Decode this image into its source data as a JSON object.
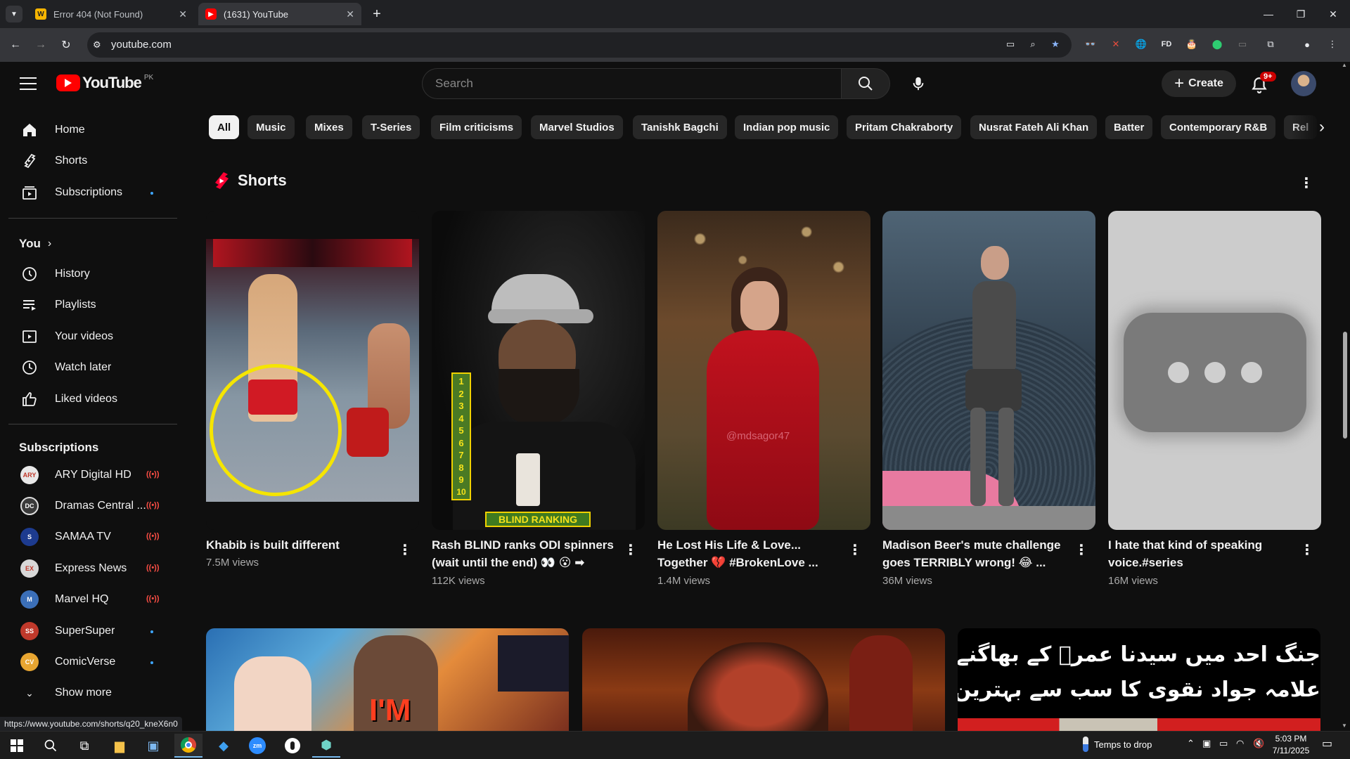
{
  "browser": {
    "tabs": [
      {
        "title": "Error 404 (Not Found)",
        "favicon": "W"
      },
      {
        "title": "(1631) YouTube",
        "favicon": "yt"
      }
    ],
    "url": "youtube.com",
    "status_url": "https://www.youtube.com/shorts/q20_kneX6n0"
  },
  "youtube": {
    "logo_text": "YouTube",
    "region": "PK",
    "search_placeholder": "Search",
    "create_label": "Create",
    "notif_badge": "9+",
    "brand_red": "#ff0000"
  },
  "sidebar": {
    "main": [
      {
        "label": "Home",
        "icon": "home-icon"
      },
      {
        "label": "Shorts",
        "icon": "shorts-icon"
      },
      {
        "label": "Subscriptions",
        "icon": "subscriptions-icon"
      }
    ],
    "you_heading": "You",
    "you": [
      {
        "label": "History",
        "icon": "history-icon"
      },
      {
        "label": "Playlists",
        "icon": "playlists-icon"
      },
      {
        "label": "Your videos",
        "icon": "your-videos-icon"
      },
      {
        "label": "Watch later",
        "icon": "watch-later-icon"
      },
      {
        "label": "Liked videos",
        "icon": "liked-icon"
      }
    ],
    "subs_heading": "Subscriptions",
    "subscriptions": [
      {
        "label": "ARY Digital HD",
        "color": "#e8e8e8",
        "text": "ARY",
        "status": "live"
      },
      {
        "label": "Dramas Central ...",
        "color": "#3a3a3a",
        "text": "DC",
        "status": "live"
      },
      {
        "label": "SAMAA TV",
        "color": "#1d3b8f",
        "text": "S",
        "status": "live"
      },
      {
        "label": "Express News",
        "color": "#d8d8d8",
        "text": "EX",
        "status": "live"
      },
      {
        "label": "Marvel HQ",
        "color": "#3b6fb8",
        "text": "M",
        "status": "live"
      },
      {
        "label": "SuperSuper",
        "color": "#c0392b",
        "text": "SS",
        "status": "dot"
      },
      {
        "label": "ComicVerse",
        "color": "#e7a531",
        "text": "CV",
        "status": "dot"
      }
    ],
    "show_more": "Show more"
  },
  "chips": [
    "All",
    "Music",
    "Mixes",
    "T-Series",
    "Film criticisms",
    "Marvel Studios",
    "Tanishk Bagchi",
    "Indian pop music",
    "Pritam Chakraborty",
    "Nusrat Fateh Ali Khan",
    "Batter",
    "Contemporary R&B",
    "Rel"
  ],
  "shorts": {
    "heading": "Shorts",
    "items": [
      {
        "title": "Khabib is built different",
        "views": "7.5M views"
      },
      {
        "title": "Rash BLIND ranks ODI spinners (wait until the end) 👀 😮 ➡",
        "views": "112K views"
      },
      {
        "title": "He Lost His Life & Love... Together 💔 #BrokenLove ...",
        "views": "1.4M views"
      },
      {
        "title": "Madison Beer's mute challenge goes TERRIBLY wrong! 😂 ...",
        "views": "36M views"
      },
      {
        "title": "I hate that kind of speaking voice.#series",
        "views": "16M views"
      }
    ],
    "thumb_texts": {
      "blind_ranking": "BLIND RANKING",
      "ranks": [
        "1",
        "2",
        "3",
        "4",
        "5",
        "6",
        "7",
        "8",
        "9",
        "10"
      ],
      "watermark": "@mdsagor47"
    }
  },
  "videos": {
    "thumb_texts": {
      "im": "I'M",
      "urdu_line1": "جنگ احد میں سیدنا عمرؓ کے بھاگنے پر اعتراض اور",
      "urdu_line2": "علامہ جواد نقوی کا سب سے بہترین جواب!"
    }
  },
  "taskbar": {
    "weather": "Temps to drop",
    "time": "5:03 PM",
    "date": "7/11/2025"
  }
}
